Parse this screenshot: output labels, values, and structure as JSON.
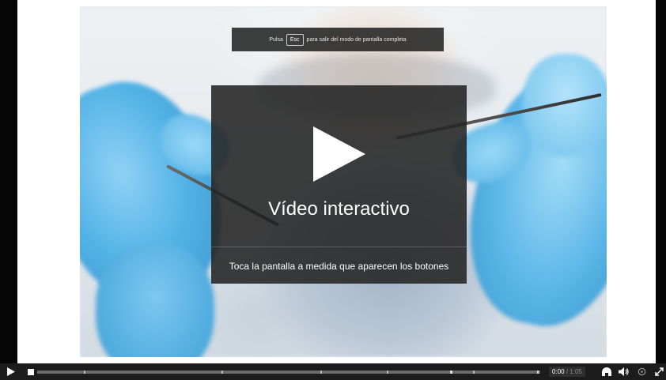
{
  "fullscreen_notice": {
    "prefix": "Pulsa",
    "key": "Esc",
    "suffix": "para salir del modo de pantalla completa"
  },
  "overlay": {
    "title": "Vídeo interactivo",
    "subtitle": "Toca la pantalla a medida que aparecen los botones",
    "play_icon": "play-icon"
  },
  "controls": {
    "play_icon": "play-icon",
    "stop_icon": "stop-icon",
    "current_time": "0:00",
    "separator": "/",
    "total_time": "1:05",
    "progress": 0.0,
    "bookmarks_icon": "bookmarks-icon",
    "volume_icon": "volume-icon",
    "quality_icon": "quality-icon",
    "fullscreen_icon": "exit-fullscreen-icon"
  },
  "colors": {
    "overlay_bg": "#232323",
    "control_bar": "#1c1c1c",
    "glove_blue": "#52b2e6"
  }
}
